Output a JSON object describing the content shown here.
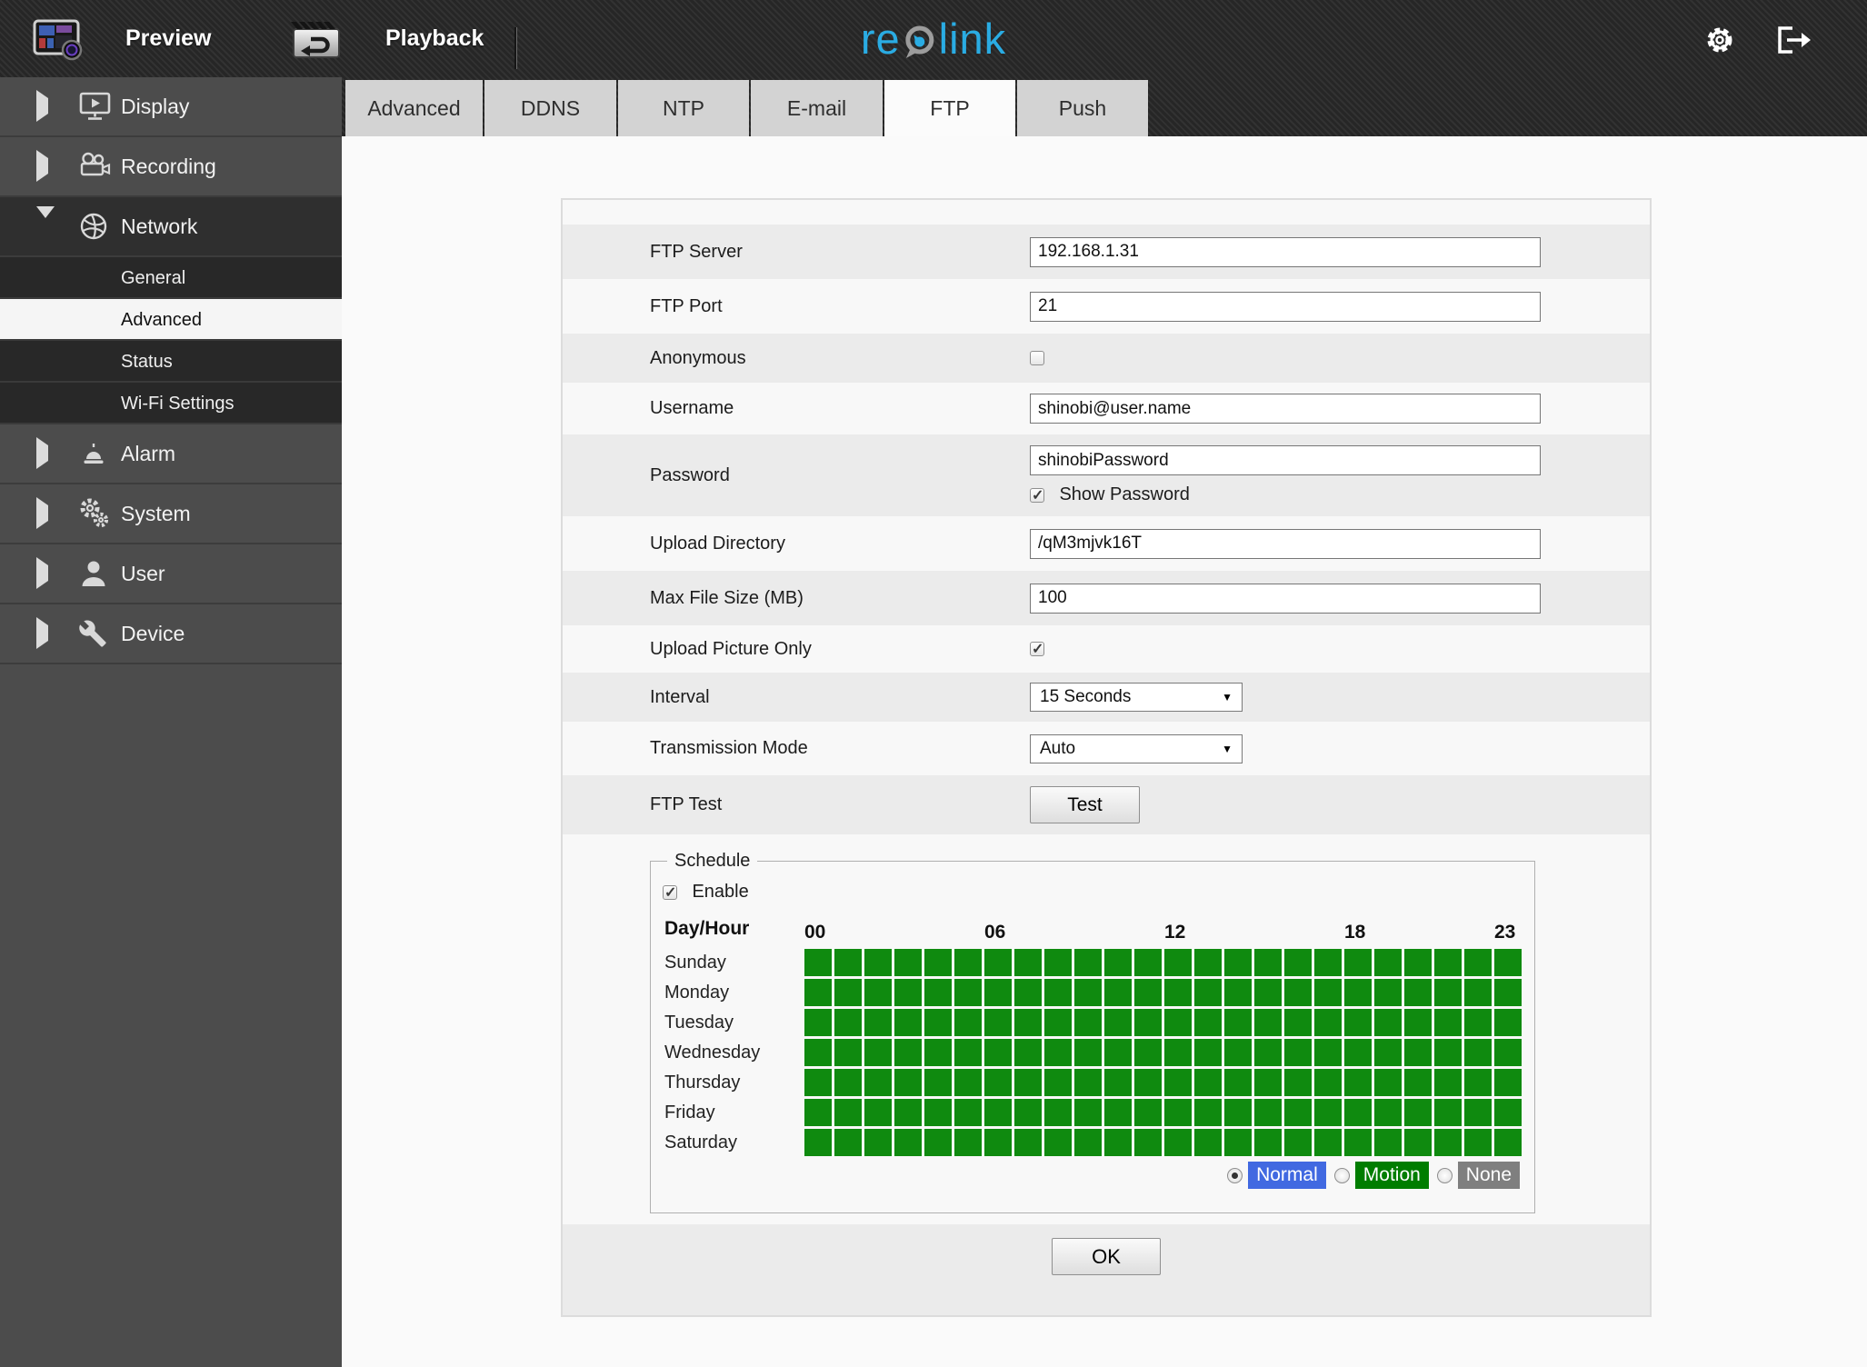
{
  "header": {
    "preview_label": "Preview",
    "playback_label": "Playback",
    "logo_re": "re",
    "logo_link": "link",
    "logo_color": "#2aace3"
  },
  "sidebar": {
    "items": [
      {
        "label": "Display"
      },
      {
        "label": "Recording"
      },
      {
        "label": "Network"
      },
      {
        "label": "Alarm"
      },
      {
        "label": "System"
      },
      {
        "label": "User"
      },
      {
        "label": "Device"
      }
    ],
    "network_children": [
      {
        "label": "General",
        "active": false
      },
      {
        "label": "Advanced",
        "active": true
      },
      {
        "label": "Status",
        "active": false
      },
      {
        "label": "Wi-Fi Settings",
        "active": false
      }
    ]
  },
  "tabs": {
    "items": [
      "Advanced",
      "DDNS",
      "NTP",
      "E-mail",
      "FTP",
      "Push"
    ],
    "active": "FTP"
  },
  "form": {
    "ftp_server": {
      "label": "FTP Server",
      "value": "192.168.1.31"
    },
    "ftp_port": {
      "label": "FTP Port",
      "value": "21"
    },
    "anonymous": {
      "label": "Anonymous",
      "checked": false
    },
    "username": {
      "label": "Username",
      "value": "shinobi@user.name"
    },
    "password": {
      "label": "Password",
      "value": "shinobiPassword",
      "show_password_label": "Show Password",
      "show_password_checked": true
    },
    "upload_directory": {
      "label": "Upload Directory",
      "value": "/qM3mjvk16T"
    },
    "max_file_size": {
      "label": "Max File Size (MB)",
      "value": "100"
    },
    "upload_picture_only": {
      "label": "Upload Picture Only",
      "checked": true
    },
    "interval": {
      "label": "Interval",
      "value": "15 Seconds"
    },
    "transmission_mode": {
      "label": "Transmission Mode",
      "value": "Auto"
    },
    "ftp_test": {
      "label": "FTP Test",
      "button_label": "Test"
    }
  },
  "schedule": {
    "legend": "Schedule",
    "enable_label": "Enable",
    "enable_checked": true,
    "day_hour_label": "Day/Hour",
    "hours": [
      "00",
      "06",
      "12",
      "18",
      "23"
    ],
    "days": [
      "Sunday",
      "Monday",
      "Tuesday",
      "Wednesday",
      "Thursday",
      "Friday",
      "Saturday"
    ],
    "columns": 24,
    "cell_color": "#0f8a0f",
    "all_cells_state": "normal",
    "modes": [
      {
        "label": "Normal",
        "color": "#4169e1",
        "selected": true
      },
      {
        "label": "Motion",
        "color": "#007d00",
        "selected": false
      },
      {
        "label": "None",
        "color": "#7f7f7f",
        "selected": false
      }
    ]
  },
  "ok_button_label": "OK"
}
